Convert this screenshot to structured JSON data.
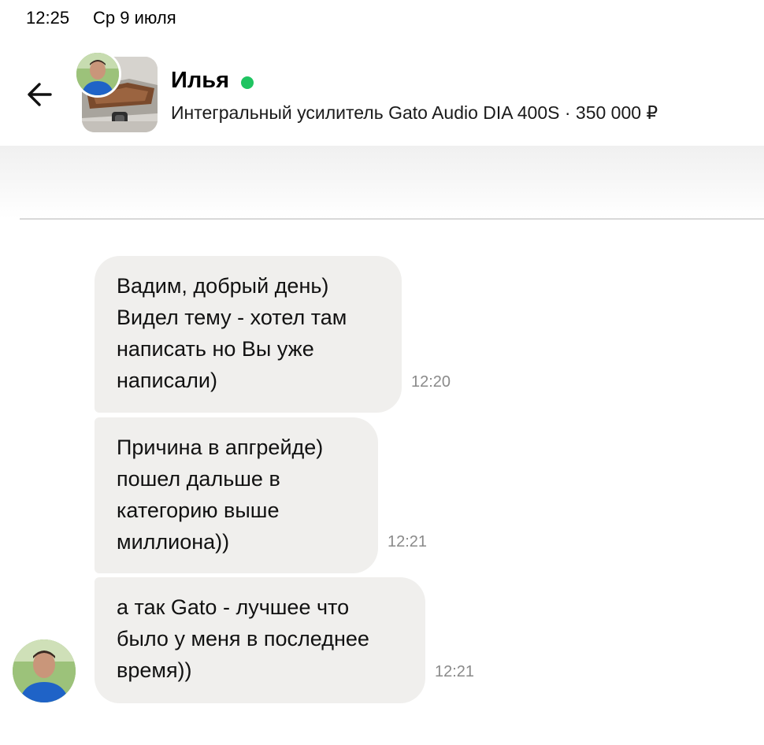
{
  "status_bar": {
    "time": "12:25",
    "date": "Ср 9 июля"
  },
  "header": {
    "contact_name": "Илья",
    "online": true,
    "listing_title": "Интегральный усилитель Gato Audio DIA 400S · 350 000 ₽"
  },
  "messages": [
    {
      "text": "Вадим, добрый день)\nВидел тему - хотел там\nнаписать но Вы уже\nнаписали)",
      "time": "12:20"
    },
    {
      "text": "Причина в апгрейде)\nпошел дальше в\nкатегорию выше\nмиллиона))",
      "time": "12:21"
    },
    {
      "text": "а так Gato - лучшее что\nбыло у меня в последнее\nвремя))",
      "time": "12:21"
    }
  ],
  "colors": {
    "online": "#1fc461",
    "bubble": "#f0efed",
    "time_text": "#8a8a8a"
  },
  "icons": {
    "back": "arrow-left-icon"
  }
}
